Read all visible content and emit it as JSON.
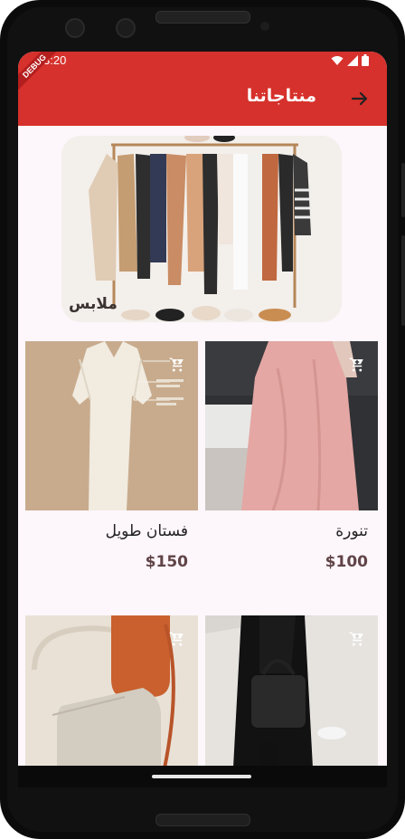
{
  "status": {
    "time": "3:20"
  },
  "debug_banner": "DEBUG",
  "appbar": {
    "title": "منتاجاتنا"
  },
  "banner": {
    "label": "ملابس"
  },
  "products": [
    {
      "name": "تنورة",
      "price": "$100"
    },
    {
      "name": "فستان طويل",
      "price": "$150"
    },
    {
      "name": "",
      "price": ""
    },
    {
      "name": "",
      "price": ""
    }
  ],
  "colors": {
    "appbar": "#d6312c",
    "background": "#fdf6fb",
    "price": "#604447"
  },
  "icons": {
    "back": "arrow-forward-icon",
    "cart": "add-shopping-cart-icon"
  }
}
